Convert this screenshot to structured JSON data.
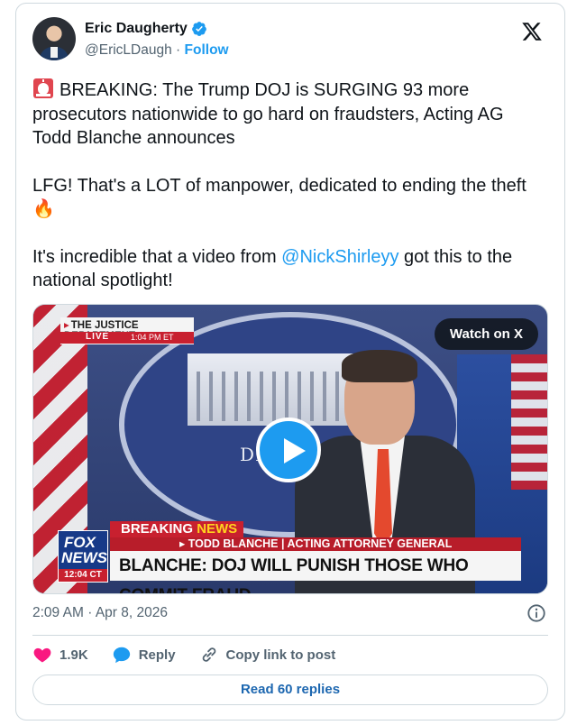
{
  "author": {
    "name": "Eric Daugherty",
    "handle": "@EricLDaugh",
    "separator": "·",
    "follow_label": "Follow"
  },
  "tweet": {
    "paragraphs": [
      "BREAKING: The Trump DOJ is SURGING 93 more prosecutors nationwide to go hard on fraudsters, Acting AG Todd Blanche announces",
      "LFG! That's a LOT of manpower, dedicated to ending the theft"
    ],
    "p3_before": "It's incredible that a video from ",
    "mention": "@NickShirleyy",
    "p3_after": " got this to the national spotlight!",
    "fire_emoji": "🔥"
  },
  "media": {
    "watch_label": "Watch on X",
    "broadcast": {
      "dept_tag": "THE JUSTICE DEPARTMENT",
      "live": "LIVE",
      "time": "1:04 PM ET",
      "seal_text": "DEPARTM",
      "breaking": "BREAKING",
      "news": "NEWS",
      "sub": "▸ TODD BLANCHE | ACTING ATTORNEY GENERAL",
      "main": "BLANCHE: DOJ WILL PUNISH THOSE WHO COMMIT FRAUD",
      "network_1": "FOX",
      "network_2": "NEWS",
      "clock": "12:04 CT"
    }
  },
  "meta": {
    "time": "2:09 AM",
    "separator": "·",
    "date": "Apr 8, 2026"
  },
  "actions": {
    "likes": "1.9K",
    "reply": "Reply",
    "copy_link": "Copy link to post"
  },
  "read_replies": "Read 60 replies",
  "colors": {
    "accent": "#1d9bf0",
    "like": "#f91880",
    "text": "#0f1419",
    "muted": "#536471"
  }
}
